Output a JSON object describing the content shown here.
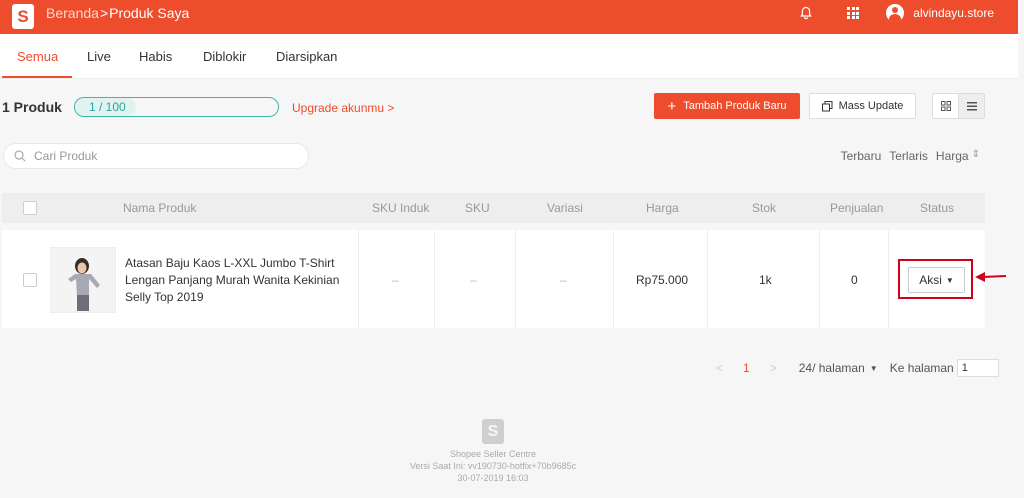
{
  "topbar": {
    "logo_letter": "S",
    "breadcrumb_home": "Beranda",
    "breadcrumb_sep": ">",
    "breadcrumb_current": "Produk Saya",
    "username": "alvindayu.store",
    "icons": [
      "bell-icon",
      "apps-grid-icon",
      "user-avatar-icon"
    ]
  },
  "tabs": [
    {
      "label": "Semua",
      "active": true
    },
    {
      "label": "Live",
      "active": false
    },
    {
      "label": "Habis",
      "active": false
    },
    {
      "label": "Diblokir",
      "active": false
    },
    {
      "label": "Diarsipkan",
      "active": false
    }
  ],
  "toolbar": {
    "product_count": "1 Produk",
    "quota_text": "1 / 100",
    "quota_fraction": 0.01,
    "upgrade_label": "Upgrade akunmu >",
    "add_button_label": "Tambah Produk Baru",
    "mass_update_label": "Mass Update"
  },
  "search": {
    "placeholder": "Cari Produk"
  },
  "sort": {
    "options": [
      "Terbaru",
      "Terlaris",
      "Harga"
    ]
  },
  "table": {
    "headers": [
      "Nama Produk",
      "SKU Induk",
      "SKU",
      "Variasi",
      "Harga",
      "Stok",
      "Penjualan",
      "Status"
    ],
    "rows": [
      {
        "name": "Atasan Baju Kaos L-XXL Jumbo T-Shirt Lengan Panjang Murah Wanita Kekinian Selly Top 2019",
        "sku_induk": "–",
        "sku": "–",
        "variasi": "–",
        "harga": "Rp75.000",
        "stok": "1k",
        "penjualan": "0",
        "action_label": "Aksi"
      }
    ]
  },
  "pagination": {
    "current_page": "1",
    "per_page": "24/ halaman",
    "goto_label": "Ke halaman",
    "goto_value": "1"
  },
  "footer": {
    "line1": "Shopee Seller Centre",
    "line2": "Versi Saat Ini: vv190730-hotfix+70b9685c",
    "line3": "30-07-2019 16:03"
  },
  "colors": {
    "brand": "#ee4d2d",
    "quota_border": "#3fb6a8",
    "highlight": "#d0021b"
  }
}
